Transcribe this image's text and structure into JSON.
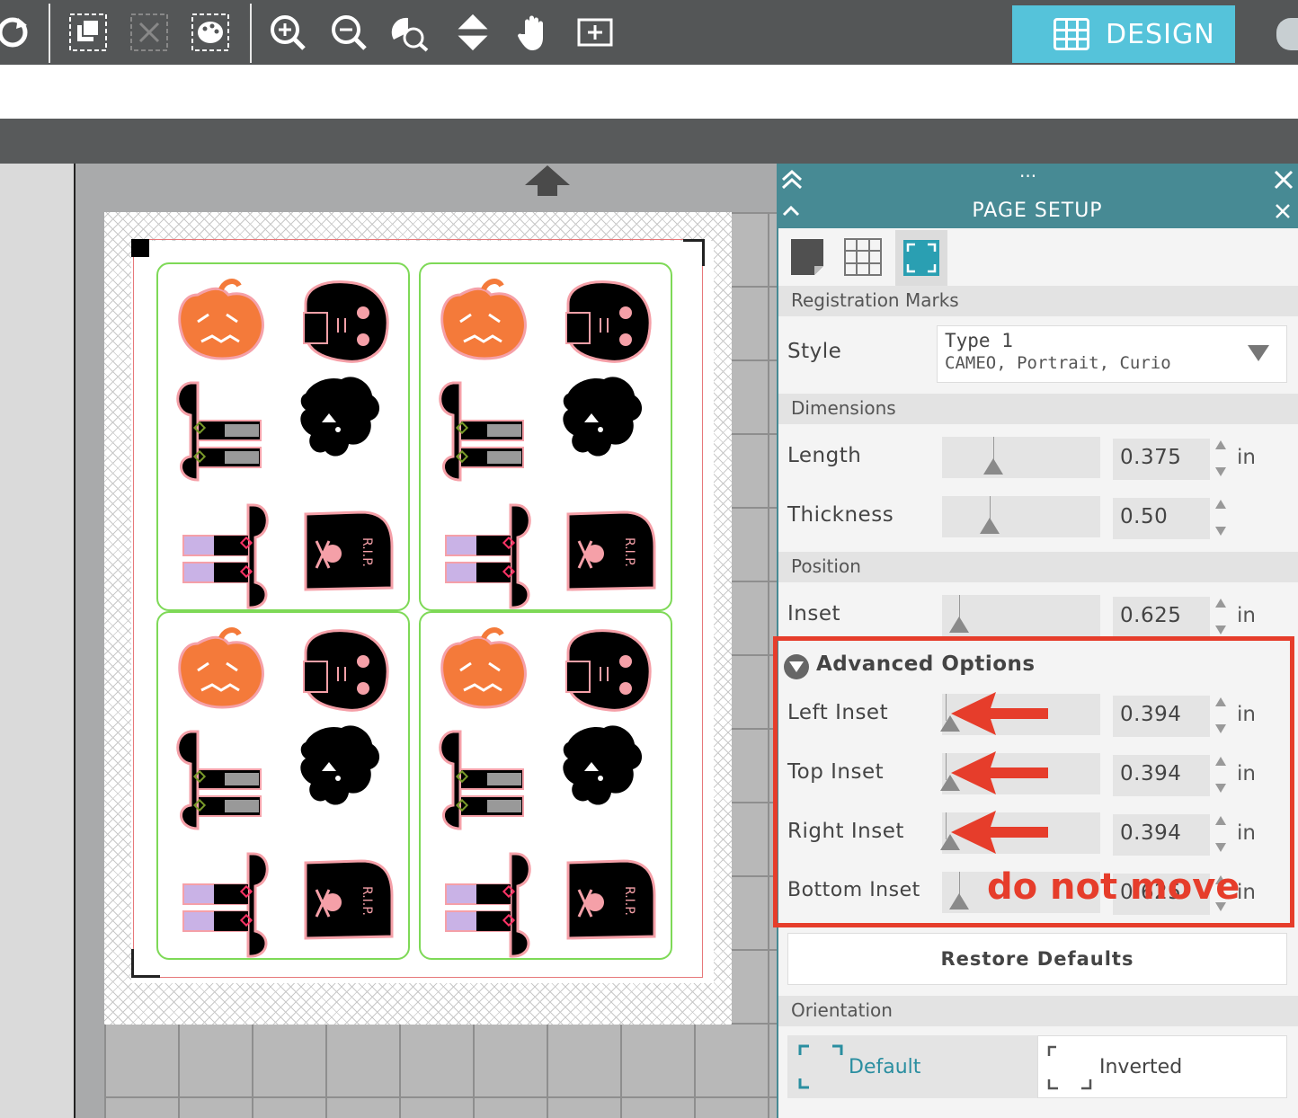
{
  "toolbar": {
    "icons": [
      "rotate-icon",
      "group-icon",
      "ungroup-icon",
      "palette-icon",
      "zoom-in-icon",
      "zoom-out-icon",
      "zoom-select-icon",
      "move-vertical-icon",
      "pan-hand-icon",
      "fit-to-page-icon"
    ],
    "design_tab_label": "DESIGN"
  },
  "panel": {
    "title": "PAGE SETUP",
    "menu_dots": "···",
    "tabs": [
      "media-tab",
      "grid-tab",
      "registration-tab"
    ],
    "sections": {
      "registration": {
        "header": "Registration Marks",
        "style_label": "Style",
        "style_value_title": "Type 1",
        "style_value_sub": "CAMEO, Portrait, Curio"
      },
      "dimensions": {
        "header": "Dimensions",
        "length_label": "Length",
        "length_value": "0.375",
        "length_unit": "in",
        "thickness_label": "Thickness",
        "thickness_value": "0.50"
      },
      "position": {
        "header": "Position",
        "inset_label": "Inset",
        "inset_value": "0.625",
        "inset_unit": "in"
      },
      "advanced": {
        "header": "Advanced Options",
        "left_label": "Left Inset",
        "left_value": "0.394",
        "left_unit": "in",
        "top_label": "Top Inset",
        "top_value": "0.394",
        "top_unit": "in",
        "right_label": "Right Inset",
        "right_value": "0.394",
        "right_unit": "in",
        "bottom_label": "Bottom Inset",
        "bottom_value": "0.625",
        "bottom_unit": "in"
      },
      "restore_label": "Restore Defaults",
      "orientation": {
        "header": "Orientation",
        "default_label": "Default",
        "inverted_label": "Inverted"
      }
    }
  },
  "annotation": {
    "text": "do not move",
    "color": "#e63d2b"
  },
  "colors": {
    "accent": "#55c3da",
    "panel_header": "#478a94",
    "cell_border": "#7ed957",
    "pumpkin": "#f47a3a",
    "cut_line": "#f5a0a8"
  }
}
